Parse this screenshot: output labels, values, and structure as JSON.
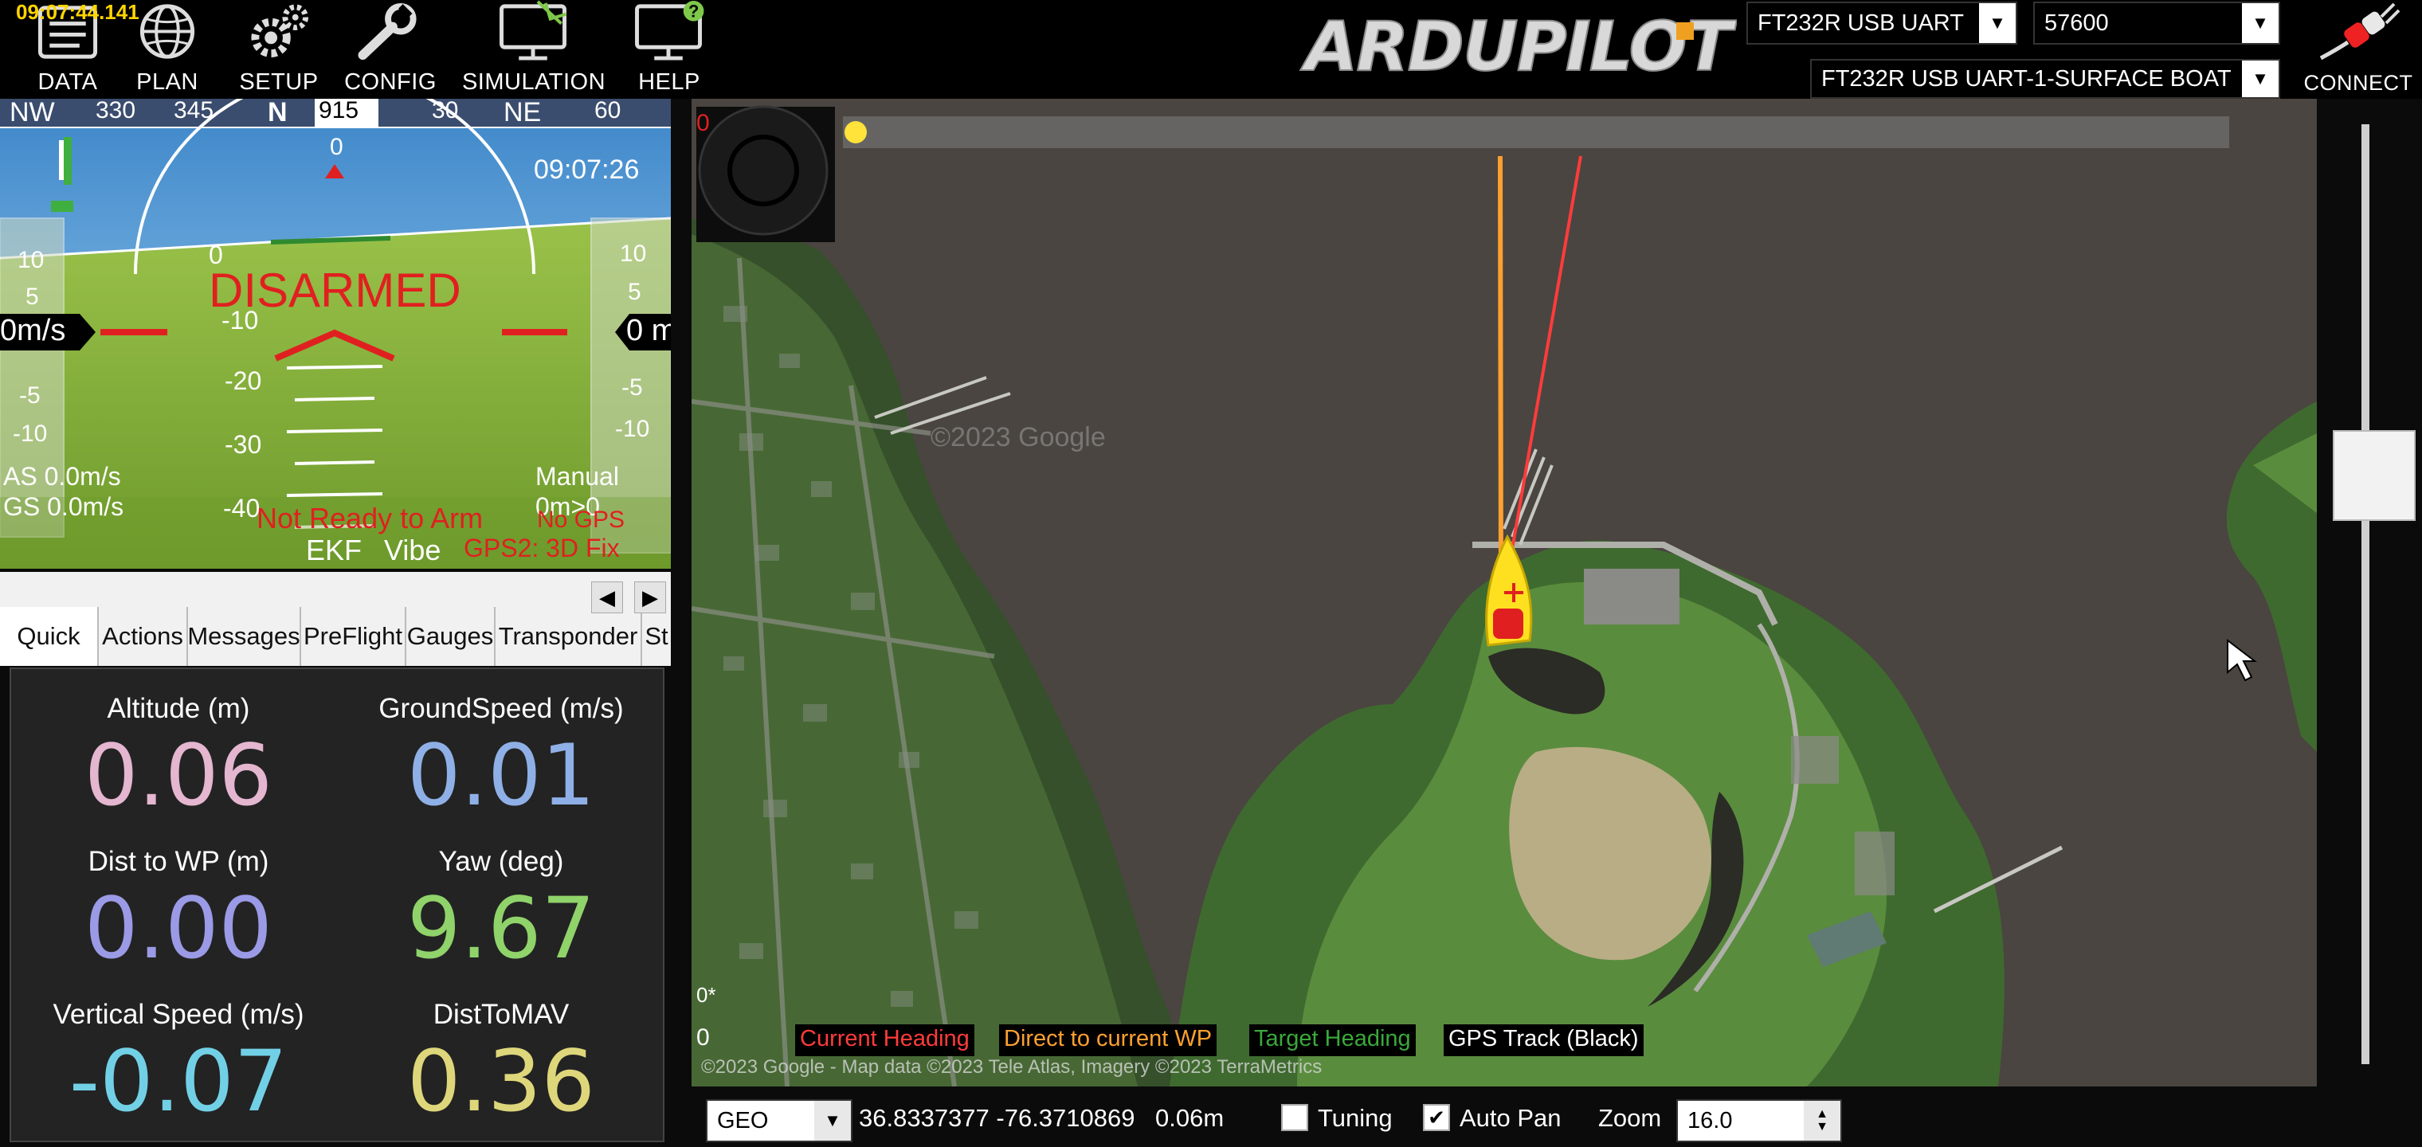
{
  "clock": "09:07:44.141",
  "menu": [
    {
      "label": "DATA",
      "icon": "data-icon"
    },
    {
      "label": "PLAN",
      "icon": "globe-icon"
    },
    {
      "label": "SETUP",
      "icon": "gears-icon"
    },
    {
      "label": "CONFIG",
      "icon": "wrench-icon"
    },
    {
      "label": "SIMULATION",
      "icon": "simulation-monitor-icon"
    },
    {
      "label": "HELP",
      "icon": "help-monitor-icon"
    }
  ],
  "logo_text": "ARDUPILOT",
  "connection": {
    "port": "FT232R USB UART",
    "baud": "57600",
    "device": "FT232R USB UART-1-SURFACE BOAT",
    "connect_label": "CONNECT",
    "connect_icon": "plug-icon"
  },
  "hud": {
    "compass": [
      "NW",
      "330",
      "345",
      "N",
      "915",
      "30",
      "NE",
      "60"
    ],
    "time": "09:07:26",
    "state": "DISARMED",
    "airspeed_box": "0m/s",
    "alt_box": "0 m",
    "speed_ticks": [
      "10",
      "5",
      "-5",
      "-10"
    ],
    "alt_ticks": [
      "10",
      "5",
      "-5",
      "-10"
    ],
    "pitch_ticks": [
      "0",
      "-10",
      "-20",
      "-30",
      "-40"
    ],
    "arc_label": "0",
    "as": "AS 0.0m/s",
    "gs": "GS 0.0m/s",
    "mode": "Manual",
    "dist": "0m>0",
    "warning": "Not Ready to Arm",
    "gps_warning": "No GPS",
    "ekf": "EKF",
    "vibe": "Vibe",
    "gps2": "GPS2: 3D Fix",
    "colors": {
      "sky": "#7ec3ee",
      "ground": "#86b843",
      "warning": "#e02020"
    }
  },
  "tabs": [
    "Quick",
    "Actions",
    "Messages",
    "PreFlight",
    "Gauges",
    "Transponder",
    "St"
  ],
  "quick": [
    {
      "label": "Altitude (m)",
      "value": "0.06",
      "color": "#e4b6cf"
    },
    {
      "label": "GroundSpeed (m/s)",
      "value": "0.01",
      "color": "#8fb0e6"
    },
    {
      "label": "Dist to WP (m)",
      "value": "0.00",
      "color": "#9a9ae6"
    },
    {
      "label": "Yaw (deg)",
      "value": "9.67",
      "color": "#8fd36a"
    },
    {
      "label": "Vertical Speed (m/s)",
      "value": "-0.07",
      "color": "#72d0e6"
    },
    {
      "label": "DistToMAV",
      "value": "0.36",
      "color": "#ded67a"
    }
  ],
  "map": {
    "counter": "0",
    "watermark": "©2023 Google",
    "corner_label": "0*",
    "corner_zero": "0",
    "legend": [
      {
        "label": "Current Heading",
        "color": "#ff3b3b"
      },
      {
        "label": "Direct to current WP",
        "color": "#ffa030"
      },
      {
        "label": "Target Heading",
        "color": "#3aa83a"
      },
      {
        "label": "GPS Track (Black)",
        "color": "#ffffff"
      }
    ],
    "attribution": "©2023 Google - Map data ©2023 Tele Atlas, Imagery ©2023 TerraMetrics"
  },
  "status": {
    "map_type": "GEO",
    "coords": "36.8337377 -76.3710869",
    "alt": "0.06m",
    "tuning_label": "Tuning",
    "tuning_checked": false,
    "autopan_label": "Auto Pan",
    "autopan_checked": true,
    "zoom_label": "Zoom",
    "zoom_value": "16.0"
  }
}
